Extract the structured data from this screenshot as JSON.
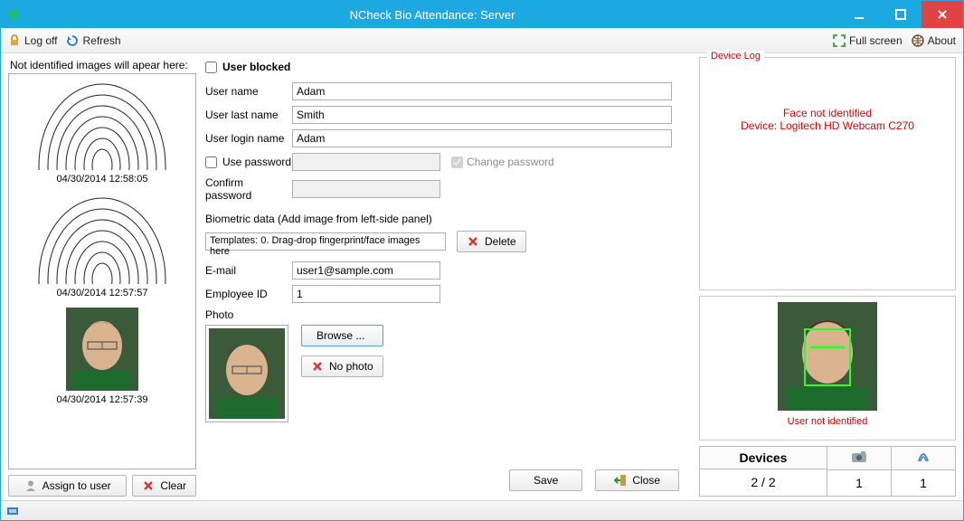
{
  "window": {
    "title": "NCheck Bio Attendance: Server"
  },
  "toolbar": {
    "logoff": "Log off",
    "refresh": "Refresh",
    "fullscreen": "Full screen",
    "about": "About"
  },
  "left": {
    "header": "Not identified images will apear here:",
    "thumbs": [
      {
        "kind": "fingerprint",
        "ts": "04/30/2014 12:58:05"
      },
      {
        "kind": "fingerprint",
        "ts": "04/30/2014 12:57:57"
      },
      {
        "kind": "face",
        "ts": "04/30/2014 12:57:39"
      }
    ],
    "assign": "Assign to user",
    "clear": "Clear"
  },
  "form": {
    "user_blocked_label": "User blocked",
    "labels": {
      "user_name": "User name",
      "last_name": "User last name",
      "login_name": "User login name",
      "use_password": "Use password",
      "change_password": "Change password",
      "confirm_password": "Confirm password",
      "biometric_hdr": "Biometric data (Add image from left-side panel)",
      "templates_box": "Templates: 0. Drag-drop fingerprint/face images here",
      "delete": "Delete",
      "email": "E-mail",
      "employee_id": "Employee ID",
      "photo": "Photo",
      "browse": "Browse ...",
      "no_photo": "No photo",
      "save": "Save",
      "close": "Close"
    },
    "values": {
      "user_name": "Adam",
      "last_name": "Smith",
      "login_name": "Adam",
      "email": "user1@sample.com",
      "employee_id": "1"
    }
  },
  "right": {
    "device_log_title": "Device Log",
    "log_line1": "Face not identified",
    "log_line2": "Device: Logitech HD Webcam C270",
    "preview_caption": "User not identified",
    "devices_header": "Devices",
    "devices_value": "2 / 2",
    "cam_count": "1",
    "fp_count": "1"
  }
}
